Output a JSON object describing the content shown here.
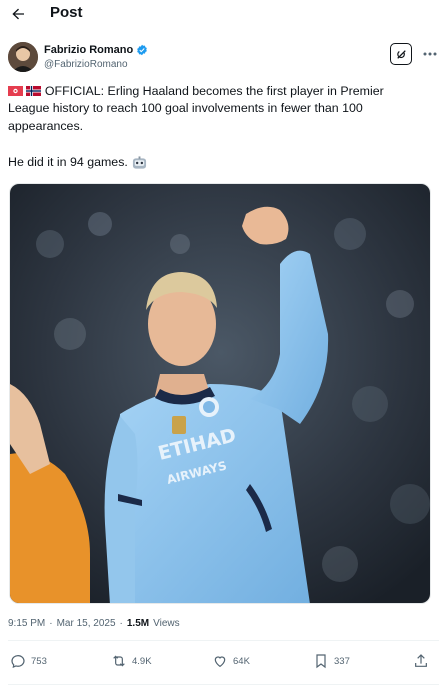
{
  "header": {
    "title": "Post",
    "back_icon": "arrow-left-icon"
  },
  "author": {
    "name": "Fabrizio Romano",
    "handle": "@FabrizioRomano",
    "verified_color": "#1d9bf0"
  },
  "tweet": {
    "line1_text": "OFFICIAL: Erling Haaland becomes the first player in Premier League history to reach 100 goal involvements in fewer than 100 appearances.",
    "line2_text": "He did it in 94 games."
  },
  "meta": {
    "time": "9:15 PM",
    "separator": "·",
    "date": "Mar 15, 2025",
    "views_count": "1.5M",
    "views_label": "Views"
  },
  "actions": {
    "replies": "753",
    "reposts": "4.9K",
    "likes": "64K",
    "bookmarks": "337"
  },
  "media": {
    "kit_text": "ETIHAD AIRWAYS",
    "colors": {
      "kit": "#8ec3ea",
      "background": "#2c3440"
    }
  }
}
